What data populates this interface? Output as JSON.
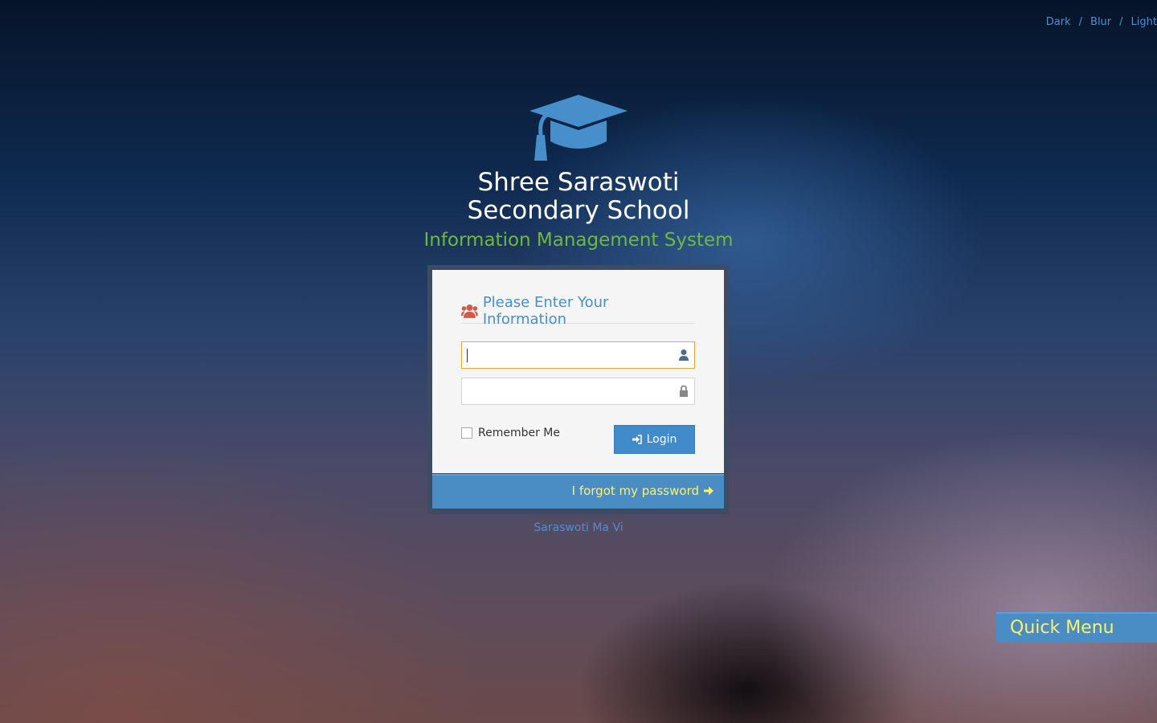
{
  "theme_switch": {
    "items": [
      "Dark",
      "Blur",
      "Light"
    ],
    "separator": "/"
  },
  "brand": {
    "icon": "graduation-cap-icon",
    "school_line1": "Shree Saraswoti",
    "school_line2": "Secondary School",
    "system_name": "Information Management System",
    "icon_color": "#478fca",
    "system_name_color": "#6fb83f"
  },
  "login": {
    "header_icon": "users-icon",
    "header_title": "Please Enter Your Information",
    "username": {
      "value": "",
      "placeholder": "",
      "icon": "user-icon",
      "focused": true
    },
    "password": {
      "value": "",
      "placeholder": "",
      "icon": "lock-icon"
    },
    "remember_label": "Remember Me",
    "remember_checked": false,
    "login_button": {
      "label": "Login",
      "icon": "sign-in-icon"
    },
    "forgot_password": {
      "label": "I forgot my password",
      "icon": "arrow-right-icon"
    }
  },
  "footer": {
    "link_text": "Saraswoti Ma Vi"
  },
  "quick_menu": {
    "label": "Quick Menu"
  },
  "colors": {
    "accent": "#428bca",
    "link_yellow": "#fff16a",
    "header_icon": "#d15b47"
  }
}
